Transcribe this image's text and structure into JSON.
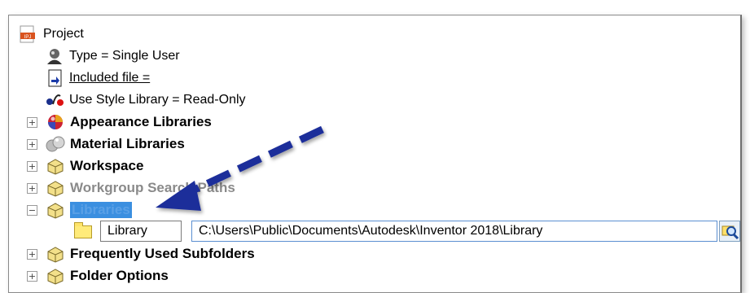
{
  "tree": {
    "root": {
      "label": "Project",
      "icon": "ipj-file-icon",
      "badge": "IPJ"
    },
    "type": {
      "label": "Type = Single User",
      "icon": "user-type-icon"
    },
    "included": {
      "label": "Included file =",
      "icon": "included-file-icon"
    },
    "style": {
      "label": "Use Style Library = Read-Only",
      "icon": "style-library-icon"
    },
    "appearance": {
      "label": "Appearance Libraries",
      "icon": "appearance-sphere-icon",
      "expander": "+"
    },
    "material": {
      "label": "Material Libraries",
      "icon": "material-spheres-icon",
      "expander": "+"
    },
    "workspace": {
      "label": "Workspace",
      "icon": "folder-cube-icon",
      "expander": "+"
    },
    "workgroup": {
      "label": "Workgroup Search Paths",
      "icon": "folder-cube-icon",
      "expander": "+"
    },
    "libraries": {
      "label": "Libraries",
      "icon": "folder-cube-icon",
      "expander": "−"
    },
    "library_entry": {
      "name": "Library",
      "path": "C:\\Users\\Public\\Documents\\Autodesk\\Inventor 2018\\Library",
      "icon": "folder-icon"
    },
    "frequent": {
      "label": "Frequently Used Subfolders",
      "icon": "folder-cube-icon",
      "expander": "+"
    },
    "folder_options": {
      "label": "Folder Options",
      "icon": "folder-cube-icon",
      "expander": "+"
    }
  },
  "browse_icon": "browse-magnifier-icon",
  "annotation": {
    "type": "arrow",
    "color": "#1e2f9a",
    "style": "dashed",
    "target": "Libraries"
  },
  "colors": {
    "selection": "#3b8fe0",
    "arrow": "#1e2f9a"
  }
}
